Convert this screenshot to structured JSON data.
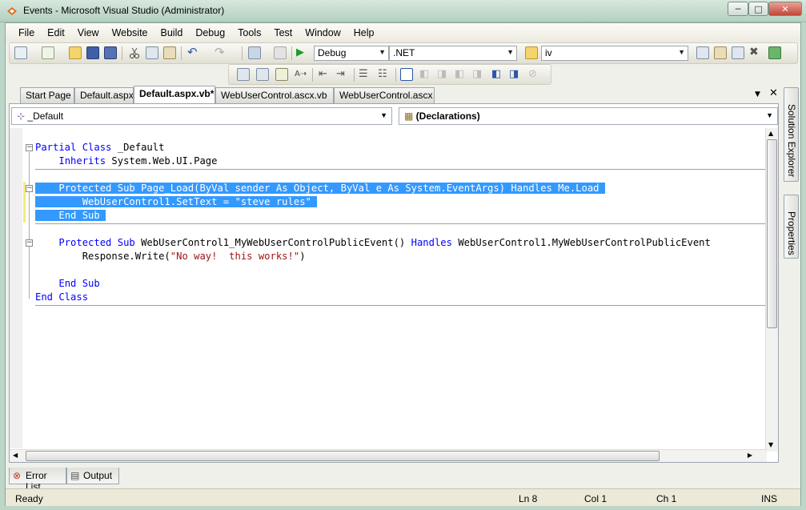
{
  "window": {
    "title": "Events - Microsoft Visual Studio (Administrator)",
    "minimize": "─",
    "maximize": "□",
    "close": "✕"
  },
  "menu": [
    "File",
    "Edit",
    "View",
    "Website",
    "Build",
    "Debug",
    "Tools",
    "Test",
    "Window",
    "Help"
  ],
  "toolbar": {
    "configuration": "Debug",
    "platform": ".NET",
    "find": "iv"
  },
  "tabs": [
    {
      "label": "Start Page",
      "active": false
    },
    {
      "label": "Default.aspx",
      "active": false
    },
    {
      "label": "Default.aspx.vb*",
      "active": true
    },
    {
      "label": "WebUserControl.ascx.vb",
      "active": false
    },
    {
      "label": "WebUserControl.ascx",
      "active": false
    }
  ],
  "tab_controls": {
    "dropdown": "▼",
    "close": "✕"
  },
  "editor": {
    "class_combo": "_Default",
    "member_combo": "(Declarations)",
    "code_lines": [
      {
        "tokens": [
          {
            "t": "Partial Class",
            "k": "kw"
          },
          {
            "t": " _Default"
          }
        ],
        "indent": 0,
        "sel": false
      },
      {
        "tokens": [
          {
            "t": "Inherits",
            "k": "kw"
          },
          {
            "t": " System.Web.UI.Page"
          }
        ],
        "indent": 4,
        "sel": false
      },
      {
        "tokens": [],
        "indent": 0,
        "sel": false
      },
      {
        "tokens": [
          {
            "t": "Protected Sub",
            "k": "kw"
          },
          {
            "t": " Page_Load("
          },
          {
            "t": "ByVal",
            "k": "kw"
          },
          {
            "t": " sender "
          },
          {
            "t": "As",
            "k": "kw"
          },
          {
            "t": " "
          },
          {
            "t": "Object",
            "k": "kw"
          },
          {
            "t": ", "
          },
          {
            "t": "ByVal",
            "k": "kw"
          },
          {
            "t": " e "
          },
          {
            "t": "As",
            "k": "kw"
          },
          {
            "t": " System.EventArgs) "
          },
          {
            "t": "Handles",
            "k": "kw"
          },
          {
            "t": " "
          },
          {
            "t": "Me",
            "k": "kw"
          },
          {
            "t": ".Load"
          }
        ],
        "indent": 4,
        "sel": true
      },
      {
        "tokens": [
          {
            "t": "WebUserControl1.SetText = "
          },
          {
            "t": "\"steve rules\"",
            "k": "str"
          }
        ],
        "indent": 8,
        "sel": true
      },
      {
        "tokens": [
          {
            "t": "End Sub",
            "k": "kw"
          }
        ],
        "indent": 4,
        "sel": true
      },
      {
        "tokens": [],
        "indent": 0,
        "sel": false
      },
      {
        "tokens": [
          {
            "t": "Protected Sub",
            "k": "kw"
          },
          {
            "t": " WebUserControl1_MyWebUserControlPublicEvent() "
          },
          {
            "t": "Handles",
            "k": "kw"
          },
          {
            "t": " WebUserControl1.MyWebUserControlPublicEvent"
          }
        ],
        "indent": 4,
        "sel": false
      },
      {
        "tokens": [
          {
            "t": "Response.Write("
          },
          {
            "t": "\"No way!  this works!\"",
            "k": "str"
          },
          {
            "t": ")"
          }
        ],
        "indent": 8,
        "sel": false
      },
      {
        "tokens": [],
        "indent": 0,
        "sel": false
      },
      {
        "tokens": [
          {
            "t": "End Sub",
            "k": "kw"
          }
        ],
        "indent": 4,
        "sel": false
      },
      {
        "tokens": [
          {
            "t": "End Class",
            "k": "kw"
          }
        ],
        "indent": 0,
        "sel": false
      }
    ]
  },
  "right_dock": [
    "Solution Explorer",
    "Properties"
  ],
  "bottom_tabs": [
    "Error List",
    "Output"
  ],
  "status": {
    "state": "Ready",
    "line": "Ln 8",
    "col": "Col 1",
    "ch": "Ch 1",
    "mode": "INS"
  },
  "colors": {
    "keyword": "#0000ff",
    "string": "#a31515",
    "selection": "#3399ff"
  }
}
